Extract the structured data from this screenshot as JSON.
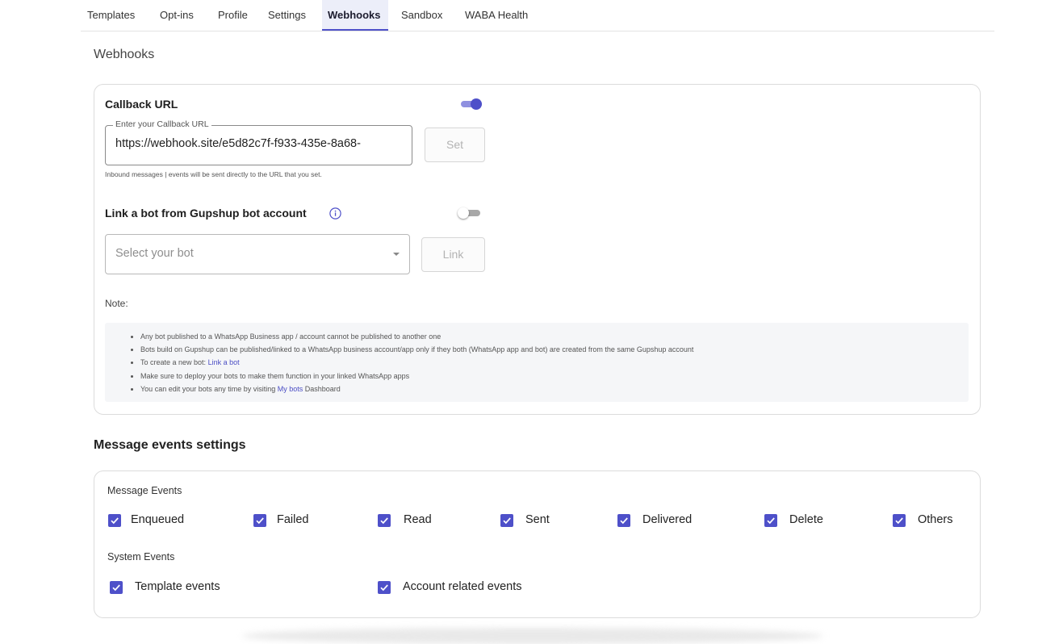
{
  "tabs": [
    "Templates",
    "Opt-ins",
    "Profile",
    "Settings",
    "Webhooks",
    "Sandbox",
    "WABA Health"
  ],
  "active_tab": "Webhooks",
  "page": {
    "title": "Webhooks"
  },
  "callback": {
    "title": "Callback URL",
    "enabled": true,
    "field_label": "Enter your Callback URL",
    "value": "https://webhook.site/e5d82c7f-f933-435e-8a68-",
    "set_button": "Set",
    "helper": "Inbound messages | events will be sent directly to the URL that you set."
  },
  "bot": {
    "title": "Link a bot from Gupshup bot account",
    "enabled": false,
    "select_placeholder": "Select your bot",
    "link_button": "Link",
    "note_label": "Note:",
    "notes": [
      {
        "text": "Any bot published to a WhatsApp Business app / account cannot be published to another one"
      },
      {
        "text": "Bots build on Gupshup can be published/linked to a WhatsApp business account/app only if they both (WhatsApp app and bot) are created from the same Gupshup account"
      },
      {
        "text": "To create a new bot: ",
        "link": "Link a bot"
      },
      {
        "text": "Make sure to deploy your bots to make them function in your linked WhatsApp apps"
      },
      {
        "text": "You can edit your bots any time by visiting ",
        "link": "My bots",
        "after": " Dashboard"
      }
    ]
  },
  "events": {
    "title": "Message events settings",
    "message_group": "Message Events",
    "message_events": [
      {
        "label": "Enqueued",
        "checked": true
      },
      {
        "label": "Failed",
        "checked": true
      },
      {
        "label": "Read",
        "checked": true
      },
      {
        "label": "Sent",
        "checked": true
      },
      {
        "label": "Delivered",
        "checked": true
      },
      {
        "label": "Delete",
        "checked": true
      },
      {
        "label": "Others",
        "checked": true
      }
    ],
    "system_group": "System Events",
    "system_events": [
      {
        "label": "Template events",
        "checked": true
      },
      {
        "label": "Account related events",
        "checked": true
      }
    ]
  },
  "colors": {
    "accent": "#4e50c9",
    "accent_light": "#8f90e0"
  }
}
